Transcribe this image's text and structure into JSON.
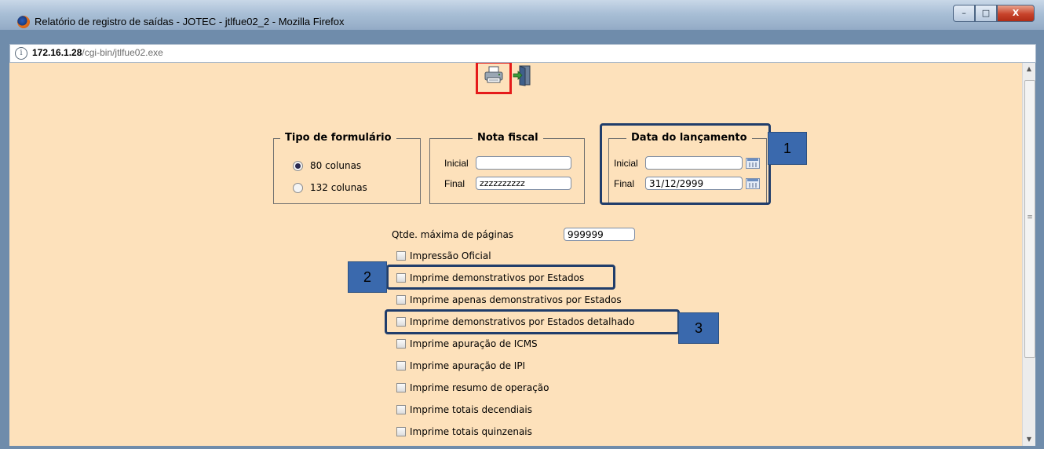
{
  "window": {
    "title": "Relatório de registro de saídas - JOTEC - jtlfue02_2 - Mozilla Firefox",
    "min_glyph": "–",
    "max_glyph": "□",
    "close_glyph": "X"
  },
  "urlbar": {
    "host": "172.16.1.28",
    "path": "/cgi-bin/jtlfue02.exe",
    "info_glyph": "i"
  },
  "toolbar": {
    "print_icon": "printer-icon",
    "exit_icon": "exit-door-icon"
  },
  "tipo_formulario": {
    "legend": "Tipo de formulário",
    "options": [
      {
        "label": "80 colunas",
        "selected": true
      },
      {
        "label": "132 colunas",
        "selected": false
      }
    ]
  },
  "nota_fiscal": {
    "legend": "Nota fiscal",
    "inicial_label": "Inicial",
    "inicial_value": "",
    "final_label": "Final",
    "final_value": "zzzzzzzzzz"
  },
  "data_lancamento": {
    "legend": "Data do lançamento",
    "inicial_label": "Inicial",
    "inicial_value": "",
    "final_label": "Final",
    "final_value": "31/12/2999",
    "calendar_icon": "calendar-icon"
  },
  "qtde_maxima": {
    "label": "Qtde. máxima de páginas",
    "value": "999999"
  },
  "options": [
    {
      "label": "Impressão Oficial",
      "checked": false
    },
    {
      "label": "Imprime demonstrativos por Estados",
      "checked": false
    },
    {
      "label": "Imprime apenas demonstrativos por Estados",
      "checked": false
    },
    {
      "label": "Imprime demonstrativos por Estados detalhado",
      "checked": false
    },
    {
      "label": "Imprime apuração de ICMS",
      "checked": false
    },
    {
      "label": "Imprime apuração de IPI",
      "checked": false
    },
    {
      "label": "Imprime resumo de operação",
      "checked": false
    },
    {
      "label": "Imprime totais decendiais",
      "checked": false
    },
    {
      "label": "Imprime totais quinzenais",
      "checked": false
    }
  ],
  "annotations": {
    "badge_1": "1",
    "badge_2": "2",
    "badge_3": "3",
    "highlight_color": "#203d6b",
    "badge_color": "#3a69ad",
    "print_highlight_color": "#e51a1a"
  },
  "scrollbar": {
    "up_glyph": "▲",
    "down_glyph": "▼",
    "grip_glyph": "≡"
  }
}
